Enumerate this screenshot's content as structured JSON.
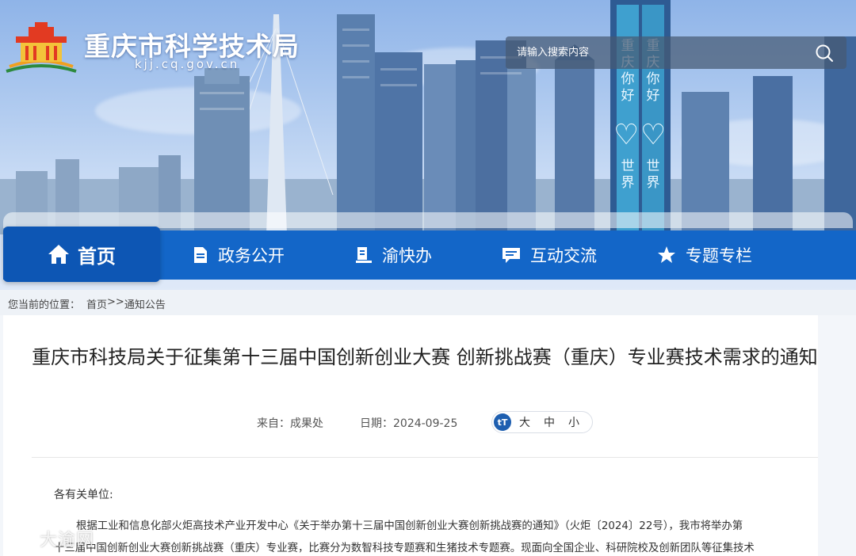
{
  "header": {
    "site_name": "重庆市科学技术局",
    "site_domain": "kjj.cq.gov.cn",
    "billboard_text": [
      "重庆你好",
      "世界",
      "重庆你好",
      "世界"
    ]
  },
  "search": {
    "placeholder": "请输入搜索内容",
    "value": ""
  },
  "nav": {
    "home": "首页",
    "items": [
      {
        "label": "政务公开",
        "icon": "document-icon"
      },
      {
        "label": "渝快办",
        "icon": "book-icon"
      },
      {
        "label": "互动交流",
        "icon": "chat-icon"
      },
      {
        "label": "专题专栏",
        "icon": "star-icon"
      }
    ]
  },
  "breadcrumb": {
    "prefix": "您当前的位置：",
    "home": "首页",
    "separator": ">>",
    "current": "通知公告"
  },
  "article": {
    "title": "重庆市科技局关于征集第十三届中国创新创业大赛 创新挑战赛（重庆）专业赛技术需求的通知",
    "source": "来自：成果处",
    "date": "日期：2024-09-25",
    "font_size": {
      "icon_label": "tT",
      "large": "大",
      "medium": "中",
      "small": "小"
    },
    "salutation": "各有关单位:",
    "paragraph_line1": "根据工业和信息化部火炬高技术产业开发中心《关于举办第十三届中国创新创业大赛创新挑战赛的通知》（火炬〔2024〕22号），我市将举办第",
    "paragraph_line2": "十三届中国创新创业大赛创新挑战赛（重庆）专业赛，比赛分为数智科技专题赛和生猪技术专题赛。现面向全国企业、科研院校及创新团队等征集技术"
  },
  "watermark": "大渝网",
  "colors": {
    "nav_blue": "#1366c8",
    "nav_home_blue": "#0d56b4",
    "search_bg": "#465a73"
  }
}
